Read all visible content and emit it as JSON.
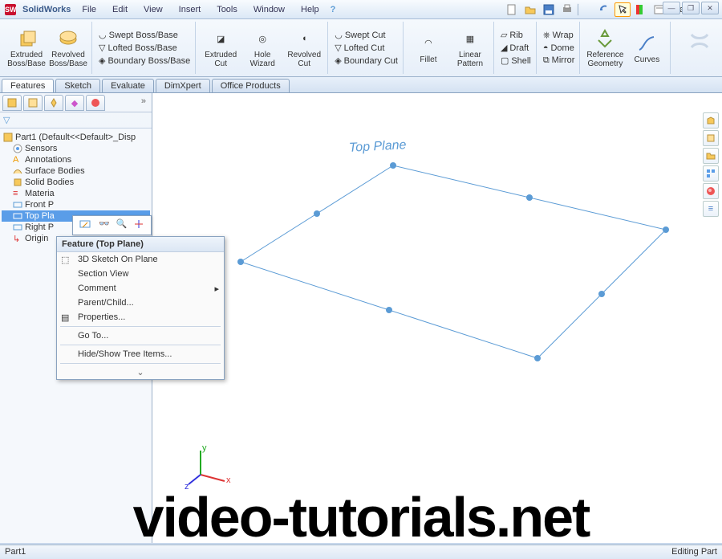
{
  "app": {
    "name": "SolidWorks",
    "doc": "Part1"
  },
  "menu": [
    "File",
    "Edit",
    "View",
    "Insert",
    "Tools",
    "Window",
    "Help"
  ],
  "ribbon": {
    "extruded_boss": "Extruded\nBoss/Base",
    "revolved_boss": "Revolved\nBoss/Base",
    "swept_boss": "Swept Boss/Base",
    "lofted_boss": "Lofted Boss/Base",
    "boundary_boss": "Boundary Boss/Base",
    "extruded_cut": "Extruded\nCut",
    "hole_wizard": "Hole\nWizard",
    "revolved_cut": "Revolved\nCut",
    "swept_cut": "Swept Cut",
    "lofted_cut": "Lofted Cut",
    "boundary_cut": "Boundary Cut",
    "fillet": "Fillet",
    "linear_pattern": "Linear\nPattern",
    "rib": "Rib",
    "draft": "Draft",
    "shell": "Shell",
    "wrap": "Wrap",
    "dome": "Dome",
    "mirror": "Mirror",
    "ref_geom": "Reference\nGeometry",
    "curves": "Curves"
  },
  "tabs": [
    "Features",
    "Sketch",
    "Evaluate",
    "DimXpert",
    "Office Products"
  ],
  "tree": {
    "root": "Part1  (Default<<Default>_Disp",
    "items": [
      "Sensors",
      "Annotations",
      "Surface Bodies",
      "Solid Bodies",
      "Materia",
      "Front P",
      "Top Pla",
      "Right P",
      "Origin"
    ],
    "selected_index": 6
  },
  "viewport": {
    "plane_label": "Top Plane"
  },
  "context": {
    "header": "Feature (Top Plane)",
    "items": [
      "3D Sketch On Plane",
      "Section View",
      "Comment",
      "Parent/Child...",
      "Properties...",
      "Go To...",
      "Hide/Show Tree Items..."
    ]
  },
  "status": {
    "left": "Part1",
    "right": "Editing Part"
  },
  "watermark": "video-tutorials.net"
}
